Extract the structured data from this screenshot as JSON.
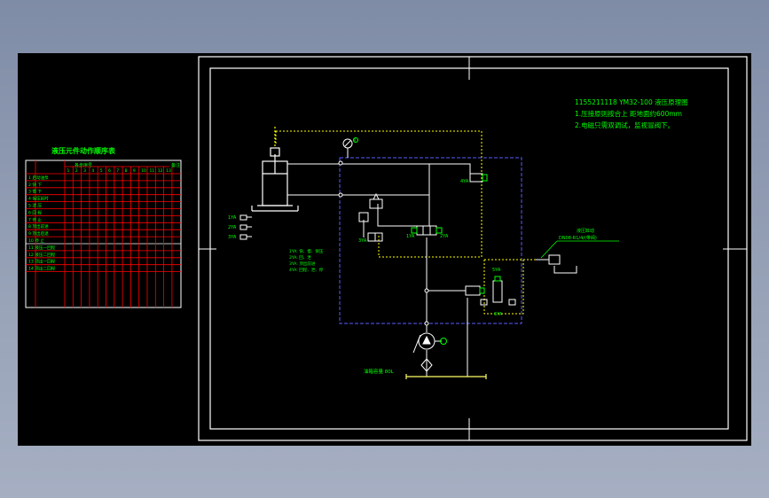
{
  "colors": {
    "background": "#000000",
    "frame": "#ffffff",
    "grid": "#ff0000",
    "text": "#00ff00",
    "dashed_signal": "#ffff00",
    "dashed_box": "#5a5aff",
    "pipe": "#ffffff"
  },
  "title_block": {
    "line1": "1155211118  YM32-100 液压原理图",
    "line2": "1.压接原则按合上 距地面约600mm",
    "line3": "2.电磁只需双调试，监视冒阀下。"
  },
  "table": {
    "title": "液压元件动作顺序表",
    "header_label": "各步序号",
    "column_numbers": [
      "1",
      "2",
      "3",
      "4",
      "5",
      "6",
      "7",
      "8",
      "9",
      "10",
      "11",
      "12",
      "13"
    ],
    "last_column": "备注",
    "rows": [
      "1 启动油泵",
      "2 快 下",
      "3 慢 下",
      "4 保压延时",
      "5 泄 压",
      "6 回 程",
      "7 停 止",
      "8 顶出前进",
      "9 顶出后退",
      "10 停 止",
      "11 液压一回程",
      "12 液压二回程",
      "13 顶出一回程",
      "14 顶出二回程"
    ]
  },
  "labels": {
    "legend": [
      "1YA",
      "2YA",
      "3YA"
    ],
    "solenoid_notes": [
      "1YA: 快、慢、保压",
      "2YA: 回、泄",
      "3YA: 顶出前进",
      "4YA: 回程、泄、停"
    ],
    "pressure_note1": "液压缸动",
    "pressure_note2": "DN08-R1/4/(带阀)",
    "valve_1ya": "1YA",
    "valve_2ya": "2YA",
    "valve_3ya": "3YA",
    "valve_4ya": "4YA",
    "valve_5ya": "5YA",
    "valve_6ya": "6YA",
    "gauge_label": "P",
    "tank_note": "油箱容量 80L"
  }
}
